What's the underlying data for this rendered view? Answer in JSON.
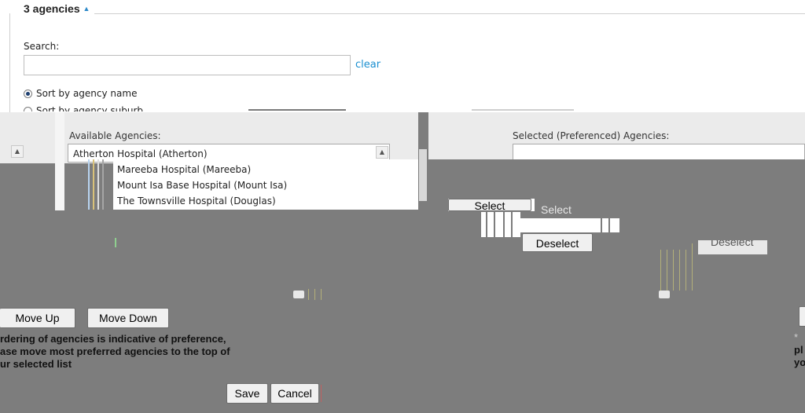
{
  "header": {
    "title": "3 agencies",
    "toggle_icon": "caret-up-icon"
  },
  "search": {
    "label": "Search:",
    "value": "",
    "placeholder": "",
    "clear_label": "clear"
  },
  "sort_options": [
    {
      "label": "Sort by agency name",
      "selected": true
    },
    {
      "label": "Sort by agency suburb",
      "selected": false
    }
  ],
  "available": {
    "label": "Available Agencies:",
    "items": [
      "Atherton Hospital (Atherton)",
      "Mareeba Hospital (Mareeba)",
      "Mount Isa Base Hospital (Mount Isa)",
      "The Townsville Hospital (Douglas)"
    ]
  },
  "selected_list": {
    "label": "Selected (Preferenced) Agencies:",
    "items": []
  },
  "buttons": {
    "select": "Select",
    "select_ghost": "Select",
    "deselect": "Deselect",
    "deselect_ghost": "Deselect",
    "move_up": "Move Up",
    "move_down": "Move Down",
    "save": "Save",
    "cancel": "Cancel"
  },
  "note": {
    "line1": "rdering of agencies is indicative of preference,",
    "line2": "ase move most preferred agencies to the top of",
    "line3": "ur selected list"
  },
  "right_fragments": {
    "mark": "*",
    "line2": "pl",
    "line3": "yo"
  },
  "colors": {
    "link": "#1a8fd0",
    "bg_gray": "#7d7d7d",
    "accent_caret": "#2b88c8"
  }
}
